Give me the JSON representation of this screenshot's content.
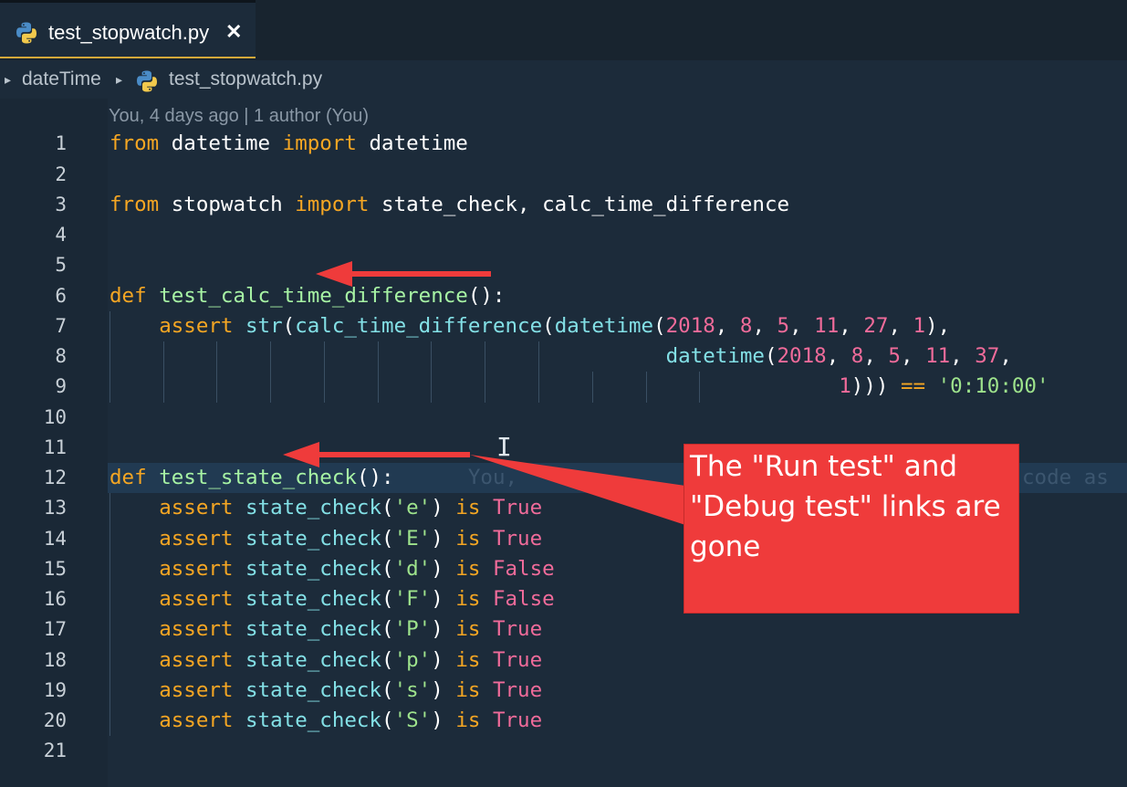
{
  "tab": {
    "title": "test_stopwatch.py",
    "close_glyph": "✕",
    "icon": "python-icon"
  },
  "breadcrumb": {
    "folder": "dateTime",
    "file": "test_stopwatch.py"
  },
  "blame_header": "You, 4 days ago | 1 author (You)",
  "line_numbers": [
    "1",
    "2",
    "3",
    "4",
    "5",
    "6",
    "7",
    "8",
    "9",
    "10",
    "11",
    "12",
    "13",
    "14",
    "15",
    "16",
    "17",
    "18",
    "19",
    "20",
    "21"
  ],
  "code": {
    "l1": [
      "from",
      " datetime ",
      "import",
      " datetime"
    ],
    "l3": [
      "from",
      " stopwatch ",
      "import",
      " state_check, calc_time_difference"
    ],
    "l6": [
      "def",
      " ",
      "test_calc_time_difference",
      "():"
    ],
    "l7": [
      "    ",
      "assert",
      " ",
      "str",
      "(",
      "calc_time_difference",
      "(",
      "datetime",
      "(",
      "2018",
      ", ",
      "8",
      ", ",
      "5",
      ", ",
      "11",
      ", ",
      "27",
      ", ",
      "1",
      "),"
    ],
    "l8": [
      "                                             ",
      "datetime",
      "(",
      "2018",
      ", ",
      "8",
      ", ",
      "5",
      ", ",
      "11",
      ", ",
      "37",
      ","
    ],
    "l9": [
      "                                                           ",
      "1",
      "))) ",
      "==",
      " ",
      "'0:10:00'"
    ],
    "l12": [
      "def",
      " ",
      "test_state_check",
      "():",
      "      You, ",
      "code as"
    ],
    "asserts": [
      {
        "arg": "'e'",
        "val": "True"
      },
      {
        "arg": "'E'",
        "val": "True"
      },
      {
        "arg": "'d'",
        "val": "False"
      },
      {
        "arg": "'F'",
        "val": "False"
      },
      {
        "arg": "'P'",
        "val": "True"
      },
      {
        "arg": "'p'",
        "val": "True"
      },
      {
        "arg": "'s'",
        "val": "True"
      },
      {
        "arg": "'S'",
        "val": "True"
      }
    ],
    "assert_kw": "assert",
    "assert_fn": "state_check",
    "assert_is": "is"
  },
  "callout": {
    "text": "The \"Run test\" and \"Debug test\" links are gone"
  },
  "colors": {
    "annotation_red": "#ef3b3b",
    "tab_accent": "#d4a93a",
    "background": "#1c2b3a"
  }
}
